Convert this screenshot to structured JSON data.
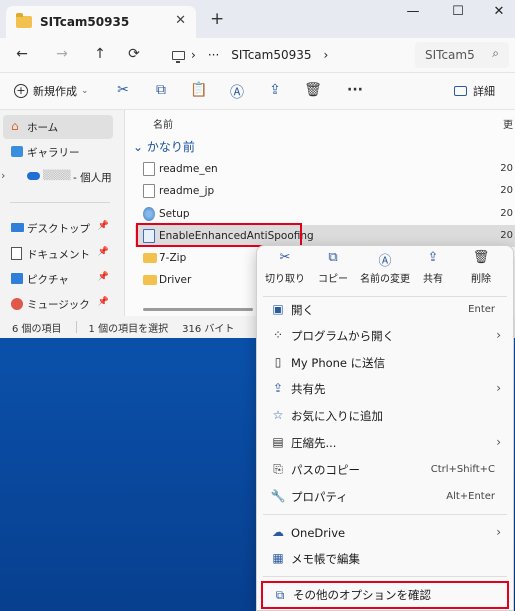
{
  "window": {
    "tab_title": "SITcam50935",
    "tab_close": "✕",
    "tab_add": "+",
    "controls": {
      "minimize": "—",
      "maximize": "☐",
      "close": "✕"
    }
  },
  "address": {
    "back": "←",
    "forward": "→",
    "up": "↑",
    "sep": "›",
    "more": "···",
    "crumb": "SITcam50935",
    "search_placeholder": "SITcam5",
    "search_icon": "⌕"
  },
  "toolbar": {
    "new_label": "新規作成",
    "new_caret": "⌄",
    "cut": "✂",
    "copy": "⧉",
    "paste": "📋",
    "rename": "Ⓐ",
    "share": "⇪",
    "delete": "🗑",
    "more": "···",
    "details_label": "詳細"
  },
  "nav": {
    "items": [
      {
        "label": "ホーム",
        "selected": true
      },
      {
        "label": "ギャラリー"
      },
      {
        "label": "- 個人用",
        "prefix_blurred": "▒▒▒▒"
      },
      {
        "label": "デスクトップ",
        "pin": "📌"
      },
      {
        "label": "ドキュメント",
        "pin": "📌"
      },
      {
        "label": "ピクチャ",
        "pin": "📌"
      },
      {
        "label": "ミュージック",
        "pin": "📌"
      }
    ],
    "expand": "›"
  },
  "files": {
    "col_name": "名前",
    "col_date": "更",
    "group": "かなり前",
    "group_chevron": "⌄",
    "rows": [
      {
        "name": "readme_en",
        "date": "20",
        "type": "doc"
      },
      {
        "name": "readme_jp",
        "date": "20",
        "type": "doc"
      },
      {
        "name": "Setup",
        "date": "20",
        "type": "setup"
      },
      {
        "name": "EnableEnhancedAntiSpoofing",
        "date": "20",
        "type": "reg",
        "selected": true
      },
      {
        "name": "7-Zip",
        "date": "",
        "type": "folder"
      },
      {
        "name": "Driver",
        "date": "",
        "type": "folder"
      }
    ]
  },
  "status": {
    "count": "6 個の項目",
    "selected": "1 個の項目を選択",
    "size": "316 バイト"
  },
  "context_menu": {
    "quick": [
      {
        "label": "切り取り",
        "glyph": "✂"
      },
      {
        "label": "コピー",
        "glyph": "⧉"
      },
      {
        "label": "名前の変更",
        "glyph": "Ⓐ"
      },
      {
        "label": "共有",
        "glyph": "⇪"
      },
      {
        "label": "削除",
        "glyph": "🗑"
      }
    ],
    "items": [
      {
        "label": "開く",
        "glyph": "▣",
        "shortcut": "Enter"
      },
      {
        "label": "プログラムから開く",
        "glyph": "⁘",
        "arrow": "›"
      },
      {
        "label": "My Phone に送信",
        "glyph": "▯"
      },
      {
        "label": "共有先",
        "glyph": "⇪",
        "arrow": "›"
      },
      {
        "label": "お気に入りに追加",
        "glyph": "☆"
      },
      {
        "label": "圧縮先...",
        "glyph": "▤",
        "arrow": "›"
      },
      {
        "label": "パスのコピー",
        "glyph": "⎘",
        "shortcut": "Ctrl+Shift+C"
      },
      {
        "label": "プロパティ",
        "glyph": "🔧",
        "shortcut": "Alt+Enter"
      },
      {
        "label": "OneDrive",
        "glyph": "☁",
        "arrow": "›"
      },
      {
        "label": "メモ帳で編集",
        "glyph": "▦"
      },
      {
        "label": "その他のオプションを確認",
        "glyph": "⧉"
      }
    ]
  }
}
